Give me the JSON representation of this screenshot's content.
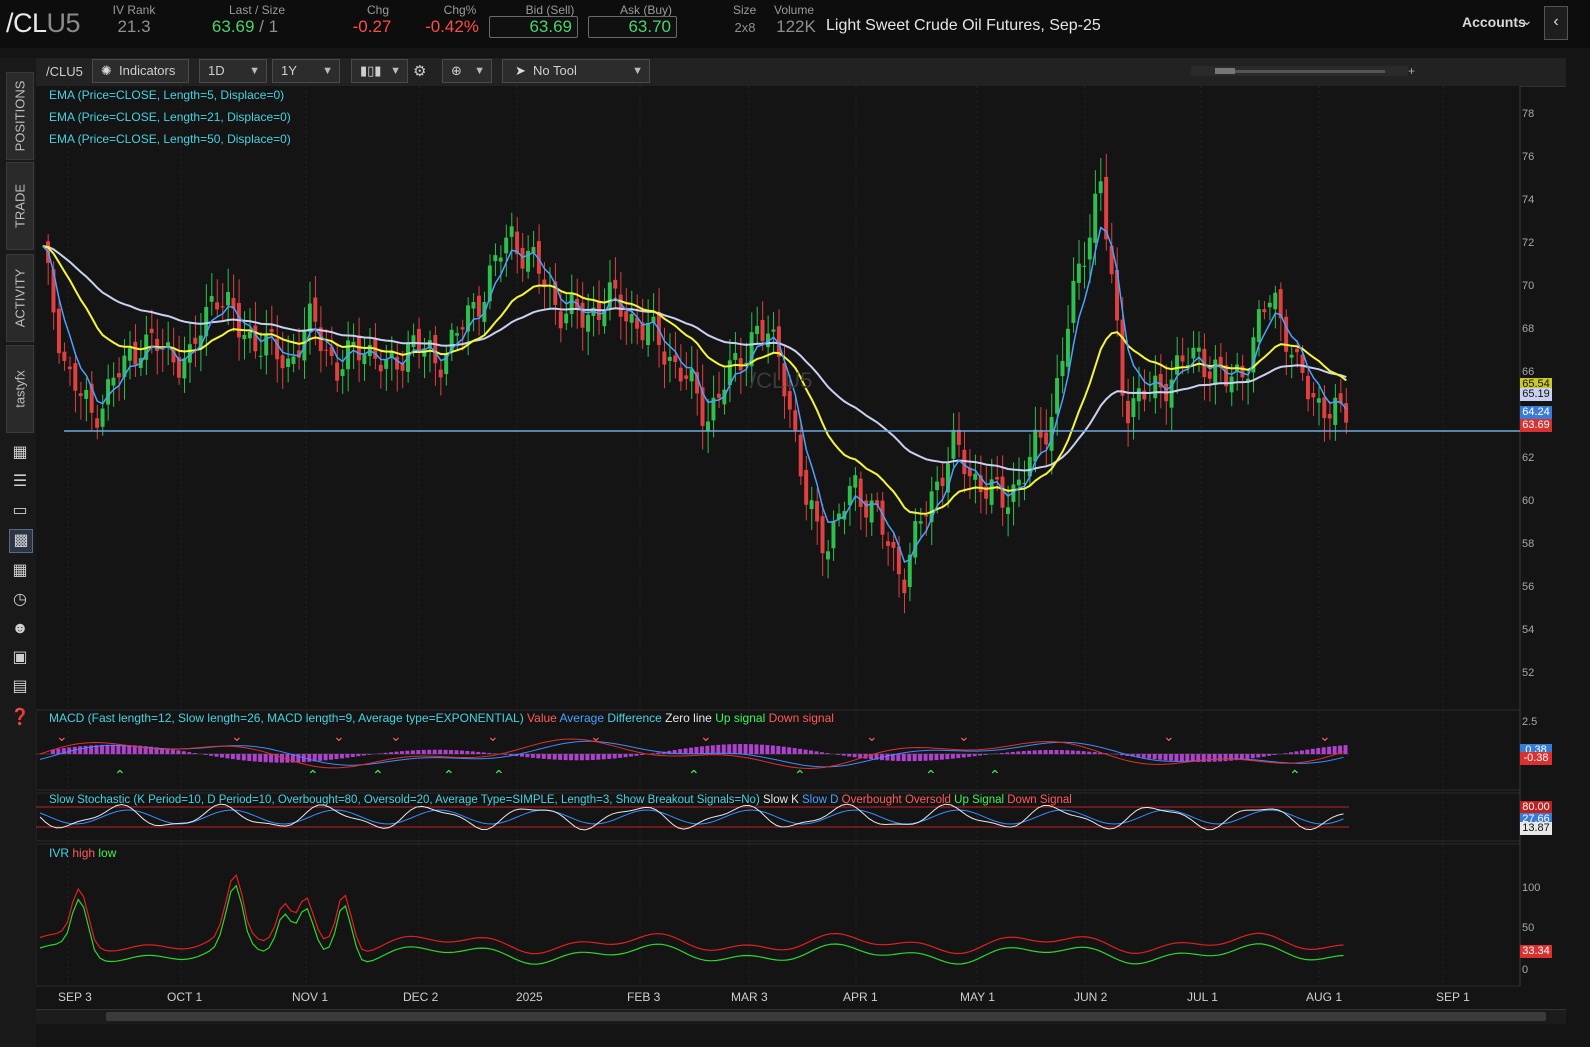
{
  "header": {
    "symbol_main": "/CL",
    "symbol_suffix": "U5",
    "ivrank_label": "IV Rank",
    "ivrank": "21.3",
    "last_label": "Last / Size",
    "last": "63.69",
    "size_sep": " / ",
    "last_size": "1",
    "chg_label": "Chg",
    "chg": "-0.27",
    "chgpct_label": "Chg%",
    "chgpct": "-0.42%",
    "bid_label": "Bid (Sell)",
    "bid": "63.69",
    "ask_label": "Ask (Buy)",
    "ask": "63.70",
    "size_label": "Size",
    "size": "2x8",
    "volume_label": "Volume",
    "volume": "122K",
    "description": "Light Sweet Crude Oil Futures, Sep-25",
    "accounts": "Accounts"
  },
  "rail": {
    "tabs": [
      "POSITIONS",
      "TRADE",
      "ACTIVITY",
      "tastyfx"
    ]
  },
  "toolbar": {
    "symbol": "/CLU5",
    "indicators": "Indicators",
    "period": "1D",
    "range": "1Y",
    "tool": "No Tool",
    "minus": "-",
    "plus": "+"
  },
  "studies": {
    "ema5": "EMA (Price=CLOSE, Length=5, Displace=0)",
    "ema21": "EMA (Price=CLOSE, Length=21, Displace=0)",
    "ema50": "EMA (Price=CLOSE, Length=50, Displace=0)",
    "macd_title": "MACD (Fast length=12, Slow length=26, MACD length=9, Average type=EXPONENTIAL)",
    "macd_value": "Value",
    "macd_average": "Average",
    "macd_difference": "Difference",
    "macd_zero": "Zero line",
    "macd_up": "Up signal",
    "macd_down": "Down signal",
    "stoch_title": "Slow Stochastic (K Period=10, D Period=10, Overbought=80, Oversold=20, Average Type=SIMPLE, Length=3, Show Breakout Signals=No)",
    "stoch_k": "Slow K",
    "stoch_d": "Slow D",
    "stoch_ob": "Overbought",
    "stoch_os": "Oversold",
    "stoch_up": "Up Signal",
    "stoch_down": "Down Signal",
    "ivr_title": "IVR",
    "ivr_high": "high",
    "ivr_low": "low"
  },
  "watermark": "/CLU5",
  "price_axis": [
    "78",
    "76",
    "74",
    "72",
    "70",
    "68",
    "66",
    "64",
    "62",
    "60",
    "58",
    "56",
    "54",
    "52"
  ],
  "price_tags": {
    "ema21": "65.54",
    "ema50": "65.19",
    "ema5": "64.24",
    "last": "63.69"
  },
  "macd_axis": [
    "2.5",
    "0.38"
  ],
  "macd_tag": "-0.38",
  "stoch_tags": {
    "ob": "80.00",
    "d": "27.66",
    "k": "13.87"
  },
  "ivr_axis": [
    "100",
    "50",
    "0"
  ],
  "ivr_tag": "33.34",
  "date_axis": [
    "SEP 3",
    "OCT 1",
    "NOV 1",
    "DEC 2",
    "2025",
    "FEB 3",
    "MAR 3",
    "APR 1",
    "MAY 1",
    "JUN 2",
    "JUL 1",
    "AUG 1",
    "SEP 1"
  ],
  "colors": {
    "up": "#2fbf4f",
    "down": "#e04040",
    "ema5": "#4aa2ff",
    "ema21": "#f5f53a",
    "ema50": "#c8d2f0",
    "support": "#6fa8dc"
  },
  "chart_data": {
    "type": "candlestick",
    "support_level": 63.3,
    "ylim": [
      51,
      79
    ],
    "ohlc_anchors_close": [
      71.5,
      66,
      64,
      65.8,
      67.5,
      67,
      66.5,
      70,
      68,
      67.3,
      66.5,
      68.5,
      66,
      67.5,
      66,
      67.5,
      66.5,
      68,
      70,
      72.5,
      71,
      69,
      68.5,
      69.5,
      68.5,
      67.5,
      66,
      64,
      66,
      68,
      67,
      60,
      58,
      61,
      59,
      56.5,
      60,
      62.5,
      61,
      60,
      61.5,
      64,
      70,
      75,
      64.5,
      65,
      66,
      67,
      65.5,
      66.5,
      70,
      66,
      64.5,
      63.69
    ],
    "ema5_end": 64.24,
    "ema21_end": 65.54,
    "ema50_end": 65.19
  }
}
